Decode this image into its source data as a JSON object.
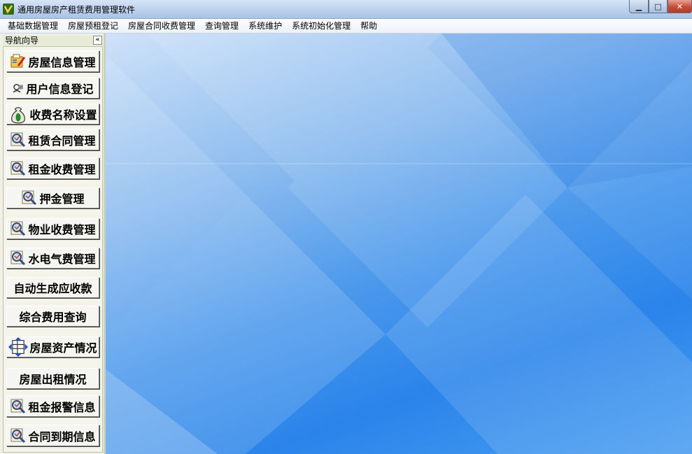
{
  "window": {
    "title": "通用房屋房产租赁费用管理软件",
    "controls": {
      "minimize": "▁",
      "maximize": "□",
      "close": "✕"
    }
  },
  "menu": {
    "items": [
      "基础数据管理",
      "房屋预租登记",
      "房屋合同收费管理",
      "查询管理",
      "系统维护",
      "系统初始化管理",
      "帮助"
    ]
  },
  "nav": {
    "title": "导航向导",
    "collapse": "«",
    "buttons": [
      {
        "label": "房屋信息管理",
        "icon": "folder-edit-icon"
      },
      {
        "label": "用户信息登记",
        "icon": "user-card-icon"
      },
      {
        "label": "收费名称设置",
        "icon": "money-bag-icon"
      },
      {
        "label": "租赁合同管理",
        "icon": "magnifier-doc-icon"
      },
      {
        "label": "租金收费管理",
        "icon": "magnifier-doc-icon"
      },
      {
        "label": "押金管理",
        "icon": "magnifier-doc-icon"
      },
      {
        "label": "物业收费管理",
        "icon": "magnifier-doc-icon"
      },
      {
        "label": "水电气费管理",
        "icon": "magnifier-doc-icon"
      },
      {
        "label": "自动生成应收款",
        "icon": ""
      },
      {
        "label": "综合费用查询",
        "icon": ""
      },
      {
        "label": "房屋资产情况",
        "icon": "table-arrows-icon"
      },
      {
        "label": "房屋出租情况",
        "icon": ""
      },
      {
        "label": "租金报警信息",
        "icon": "magnifier-doc-icon"
      },
      {
        "label": "合同到期信息",
        "icon": "magnifier-doc-icon"
      }
    ]
  },
  "colors": {
    "accent": "#2a84ea",
    "title_bar": "#c1d5ee",
    "nav_bg": "#f0f0e6"
  }
}
